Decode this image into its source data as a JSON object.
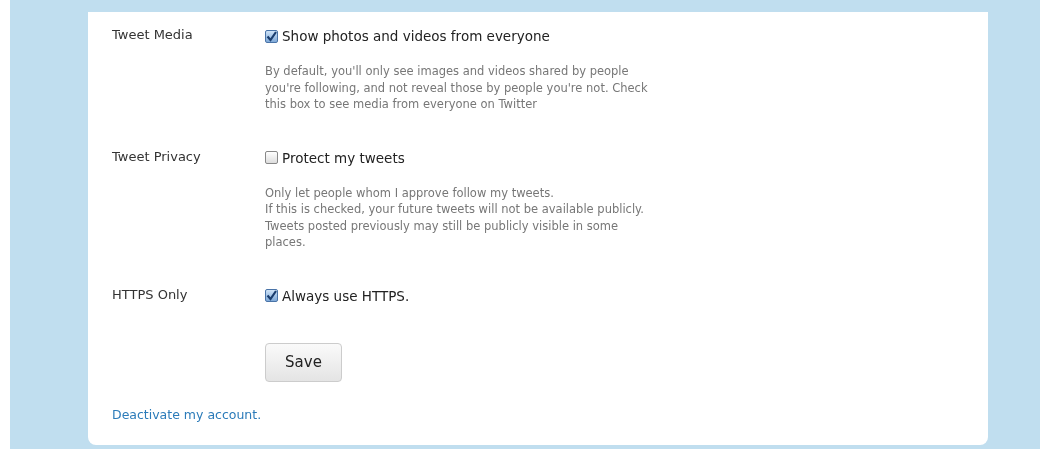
{
  "settings": [
    {
      "label": "Tweet Media",
      "option": "Show photos and videos from everyone",
      "checked": true,
      "description": [
        "By default, you'll only see images and videos shared by people",
        "you're following, and not reveal those by people you're not. Check",
        "this box to see media from everyone on Twitter"
      ]
    },
    {
      "label": "Tweet Privacy",
      "option": "Protect my tweets",
      "checked": false,
      "description": [
        "Only let people whom I approve follow my tweets.",
        "If this is checked, your future tweets will not be available publicly.",
        "Tweets posted previously may still be publicly visible in some",
        "places."
      ]
    },
    {
      "label": "HTTPS Only",
      "option": "Always use HTTPS.",
      "checked": true
    }
  ],
  "save_button": "Save",
  "deactivate_link": "Deactivate my account."
}
